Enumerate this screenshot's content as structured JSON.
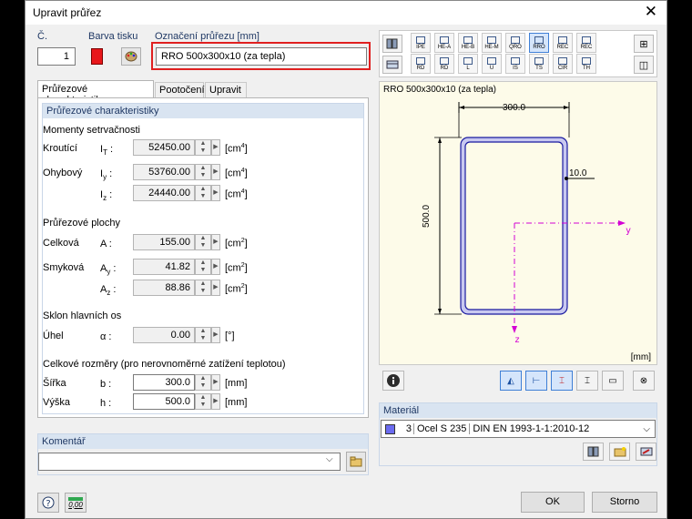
{
  "window": {
    "title": "Upravit průřez",
    "close_glyph": "✕"
  },
  "header": {
    "no_label": "Č.",
    "no_value": "1",
    "color_label": "Barva tisku",
    "name_label": "Označení průřezu [mm]",
    "name_value": "RRO 500x300x10 (za tepla)",
    "print_color": "#e8171b"
  },
  "toolbar": {
    "row1": [
      "IPE",
      "HE-A",
      "HE-B",
      "HE-M",
      "QRO",
      "RRO",
      "REC",
      "REC"
    ],
    "row2": [
      "RD",
      "RD",
      "L",
      "U",
      "IS",
      "TS",
      "CIR",
      "TH"
    ]
  },
  "tabs": [
    "Průřezové charakteristiky",
    "Pootočení",
    "Upravit"
  ],
  "props": {
    "group_title": "Průřezové charakteristiky",
    "moments_heading": "Momenty setrvačnosti",
    "torsion_label": "Kroutící",
    "it_sym": "IT",
    "it_value": "52450.00",
    "it_unit": "[cm4]",
    "bending_label": "Ohybový",
    "iy_sym": "Iy",
    "iy_value": "53760.00",
    "iy_unit": "[cm4]",
    "iz_sym": "Iz",
    "iz_value": "24440.00",
    "iz_unit": "[cm4]",
    "areas_heading": "Průřezové plochy",
    "total_label": "Celková",
    "a_sym": "A",
    "a_value": "155.00",
    "a_unit": "[cm2]",
    "shear_label": "Smyková",
    "ay_sym": "Ay",
    "ay_value": "41.82",
    "ay_unit": "[cm2]",
    "az_sym": "Az",
    "az_value": "88.86",
    "az_unit": "[cm2]",
    "tilt_heading": "Sklon hlavních os",
    "angle_label": "Úhel",
    "alpha_sym": "α",
    "alpha_value": "0.00",
    "alpha_unit": "[°]",
    "dims_heading": "Celkové rozměry (pro nerovnoměrné zatížení teplotou)",
    "width_label": "Šířka",
    "b_sym": "b",
    "b_value": "300.0",
    "b_unit": "[mm]",
    "height_label": "Výška",
    "h_sym": "h",
    "h_value": "500.0",
    "h_unit": "[mm]"
  },
  "comment": {
    "label": "Komentář",
    "value": ""
  },
  "preview": {
    "title": "RRO 500x300x10 (za tepla)",
    "dim_width": "300.0",
    "dim_height": "500.0",
    "dim_thickness": "10.0",
    "axis_y": "y",
    "axis_z": "z",
    "unit": "[mm]"
  },
  "material": {
    "label": "Materiál",
    "number": "3",
    "name": "Ocel S 235",
    "standard": "DIN EN 1993-1-1:2010-12",
    "swatch_color": "#6b6bf0"
  },
  "footer": {
    "ok": "OK",
    "cancel": "Storno",
    "calc_label": "0,00"
  }
}
